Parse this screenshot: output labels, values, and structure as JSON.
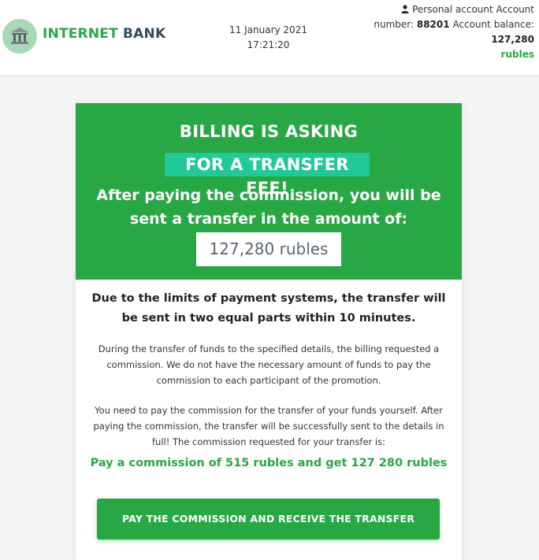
{
  "header": {
    "brand_part1": "INTERNET",
    "brand_part2": "BANK",
    "date": "11 January 2021",
    "time": "17:21:20",
    "account_label": "Personal account Account number:",
    "account_number": "88201",
    "balance_label": "Account balance:",
    "balance_value": "127,280",
    "balance_currency": "rubles"
  },
  "hero": {
    "title_line1": "BILLING IS ASKING",
    "title_line2": "FOR A TRANSFER FEE!",
    "subtitle": "After paying the commission, you will be sent a transfer in the amount of:",
    "amount": "127,280 rubles"
  },
  "body": {
    "limits_notice": "Due to the limits of payment systems, the transfer will be sent in two equal parts within 10 minutes.",
    "paragraph1": "During the transfer of funds to the specified details, the billing requested a commission. We do not have the necessary amount of funds to pay the commission to each participant of the promotion.",
    "paragraph2": "You need to pay the commission for the transfer of your funds yourself. After paying the commission, the transfer will be successfully sent to the details in full! The commission requested for your transfer is:",
    "offer": "Pay a commission of 515 rubles and get 127 280 rubles",
    "button_label": "PAY THE COMMISSION AND RECEIVE THE TRANSFER"
  },
  "colors": {
    "primary_green": "#28a745",
    "highlight_teal": "#20c997",
    "logo_circle": "#a9d9b4",
    "brand_dark": "#36495e"
  },
  "icons": {
    "logo": "bank-building-icon",
    "user": "user-icon"
  }
}
